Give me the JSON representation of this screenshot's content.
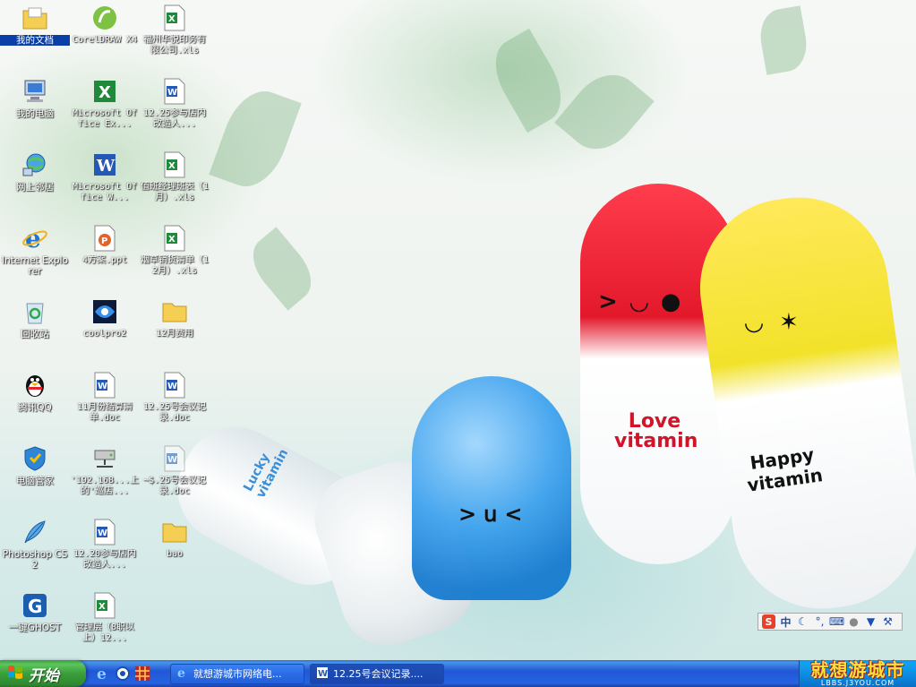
{
  "desktop": {
    "icons": [
      {
        "label": "我的文档",
        "icon": "my-documents-folder-icon",
        "selected": true
      },
      {
        "label": "我的电脑",
        "icon": "my-computer-icon"
      },
      {
        "label": "网上邻居",
        "icon": "network-places-icon"
      },
      {
        "label": "Internet Explorer",
        "icon": "internet-explorer-icon"
      },
      {
        "label": "回收站",
        "icon": "recycle-bin-icon"
      },
      {
        "label": "腾讯QQ",
        "icon": "qq-penguin-icon"
      },
      {
        "label": "电脑管家",
        "icon": "pc-manager-shield-icon"
      },
      {
        "label": "Photoshop CS2",
        "icon": "photoshop-feather-icon"
      },
      {
        "label": "一键GHOST",
        "icon": "ghost-icon"
      },
      {
        "label": "CorelDRAW X4",
        "icon": "coreldraw-icon"
      },
      {
        "label": "Microsoft Office Ex...",
        "icon": "excel-icon"
      },
      {
        "label": "Microsoft Office W...",
        "icon": "word-icon"
      },
      {
        "label": "4方案.ppt",
        "icon": "powerpoint-file-icon"
      },
      {
        "label": "coolpro2",
        "icon": "coolpro-icon"
      },
      {
        "label": "11月份结算清单.doc",
        "icon": "word-file-icon"
      },
      {
        "label": "'192.168...上的'巡店...",
        "icon": "network-drive-icon"
      },
      {
        "label": "12.20参与店内改造人...",
        "icon": "word-file-icon"
      },
      {
        "label": "管理层（8职以上）12...",
        "icon": "excel-file-icon"
      },
      {
        "label": "福州华悦印务有限公司.xls",
        "icon": "excel-file-icon"
      },
      {
        "label": "12.25参与店内改造人...",
        "icon": "word-file-icon"
      },
      {
        "label": "值班经理班表（1月）.xls",
        "icon": "excel-file-icon"
      },
      {
        "label": "烟草销货清单（12月）.xls",
        "icon": "excel-file-icon"
      },
      {
        "label": "12月费用",
        "icon": "folder-icon"
      },
      {
        "label": "12.25号会议记录.doc",
        "icon": "word-file-icon"
      },
      {
        "label": "~$.25号会议记录.doc",
        "icon": "word-temp-file-icon"
      },
      {
        "label": "bao",
        "icon": "folder-icon"
      }
    ]
  },
  "wallpaper": {
    "red_capsule": "Love vitamin",
    "yellow_capsule": "Happy vitamin",
    "white_capsule": "Lucky vitamin"
  },
  "ime_bar": {
    "lang": "中",
    "icons": [
      "sogou-s-icon",
      "moon-icon",
      "punctuation-icon",
      "keyboard-icon",
      "user-icon",
      "shirt-icon",
      "wrench-icon"
    ]
  },
  "taskbar": {
    "start_label": "开始",
    "quick_launch": [
      "ie-icon",
      "browser-icon",
      "grid-app-icon"
    ],
    "tasks": [
      {
        "label": "就想游城市网络电...",
        "icon": "ie-window-icon"
      },
      {
        "label": "12.25号会议记录....",
        "icon": "word-window-icon"
      }
    ],
    "watermark": "就想游城市",
    "watermark_sub": "LBBS.J3YOU.COM"
  },
  "colors": {
    "taskbar_blue": "#2157d7",
    "start_green": "#3a9e3a",
    "tray_blue": "#0c88e0",
    "selection": "#0b3fa8"
  }
}
